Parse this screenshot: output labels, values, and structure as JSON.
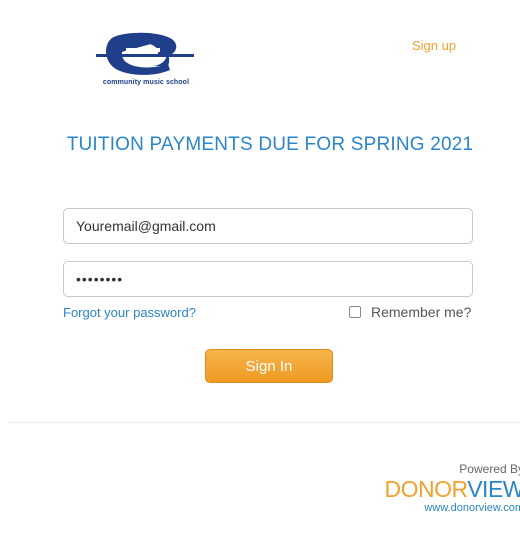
{
  "header": {
    "logo_text": "community music school",
    "signup_label": "Sign up"
  },
  "main": {
    "title": "TUITION PAYMENTS DUE FOR SPRING 2021",
    "email_value": "Youremail@gmail.com",
    "password_value": "••••••••",
    "forgot_label": "Forgot your password?",
    "remember_label": "Remember me?",
    "remember_checked": false,
    "signin_label": "Sign In"
  },
  "footer": {
    "powered_by": "Powered By",
    "brand_part1": "DONOR",
    "brand_part2": "VIEW",
    "brand_url": "www.donorview.com"
  },
  "colors": {
    "accent_orange": "#f2a12e",
    "accent_blue": "#2a86c8",
    "logo_navy": "#1f3f8a"
  }
}
